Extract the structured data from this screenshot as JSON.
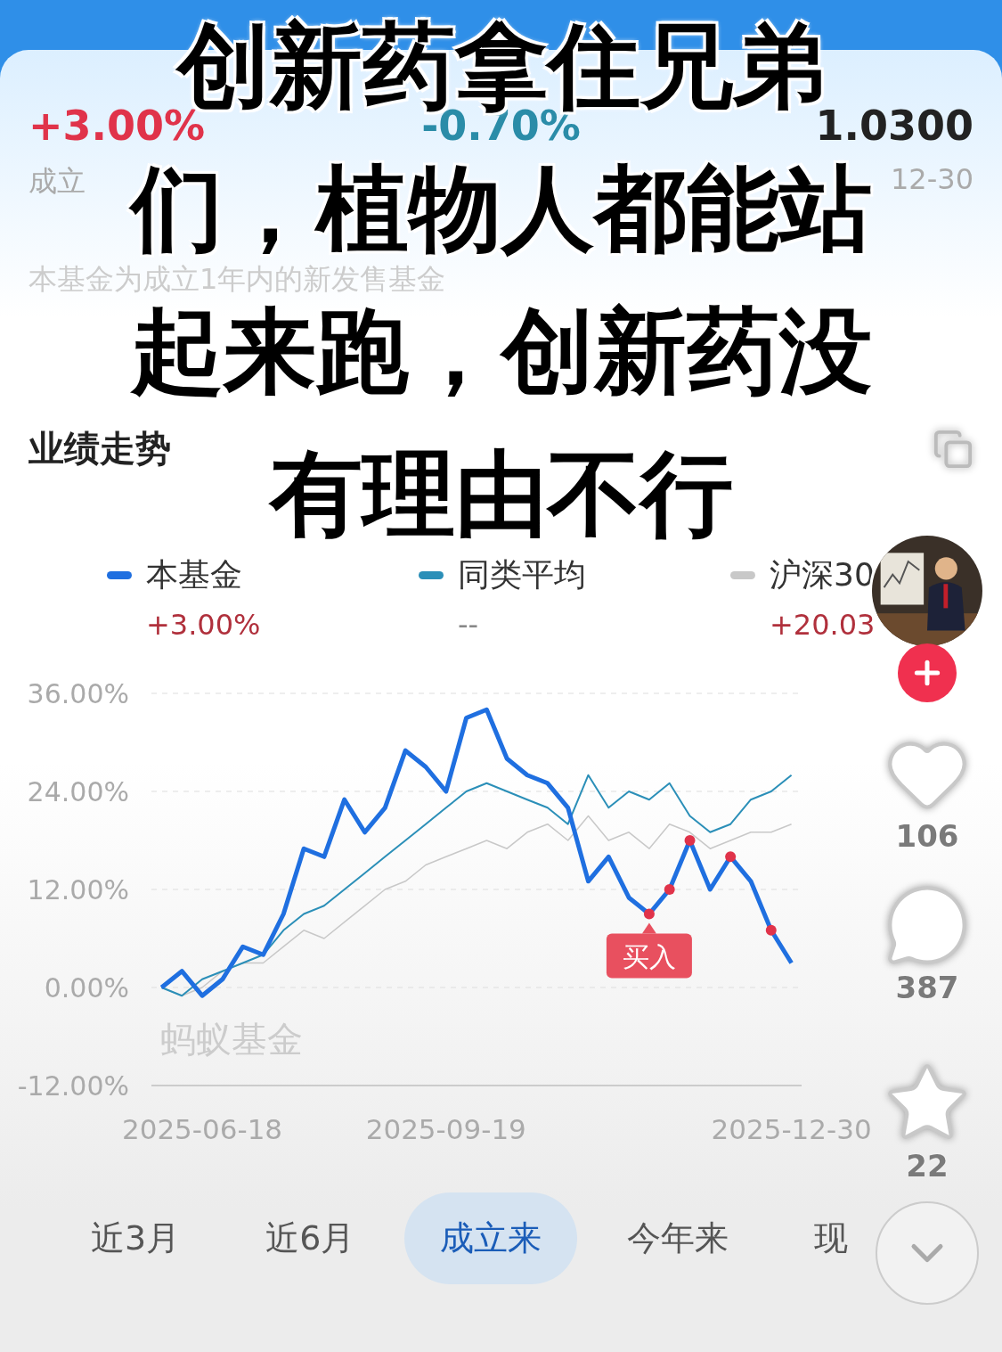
{
  "caption": {
    "lines": [
      "创新药拿住兄弟",
      "们，植物人都能站",
      "起来跑，创新药没",
      "有理由不行"
    ]
  },
  "stats": [
    {
      "value": "+3.00%",
      "label": "成立"
    },
    {
      "value": "-0.70%"
    },
    {
      "value": "1.0300",
      "label": "12-30"
    }
  ],
  "notice": "本基金为成立1年内的新发售基金",
  "section": {
    "title": "业绩走势"
  },
  "legend": [
    {
      "value": "+3.00%"
    },
    {
      "value": "--"
    },
    {
      "value": "+20.03"
    }
  ],
  "chart": {
    "watermark": "蚂蚁基金",
    "chart_data": {
      "type": "line",
      "grid": true,
      "ylim": [
        -12,
        36
      ],
      "yticks": [
        {
          "value": 36,
          "label": "36.00%"
        },
        {
          "value": 24,
          "label": "24.00%"
        },
        {
          "value": 12,
          "label": "12.00%"
        },
        {
          "value": 0,
          "label": "0.00%"
        },
        {
          "value": -12,
          "label": "-12.00%"
        }
      ],
      "categories": [
        null,
        null,
        "2025-06-18",
        null,
        null,
        null,
        null,
        null,
        null,
        null,
        null,
        null,
        null,
        null,
        "2025-09-19",
        null,
        null,
        null,
        null,
        null,
        null,
        null,
        null,
        null,
        null,
        null,
        null,
        null,
        null,
        null,
        null,
        "2025-12-30"
      ],
      "series": [
        {
          "name": "本基金",
          "color": "#1f6fe0",
          "values": [
            0,
            2,
            -1,
            1,
            5,
            4,
            9,
            17,
            16,
            23,
            19,
            22,
            29,
            27,
            24,
            33,
            34,
            28,
            26,
            25,
            22,
            13,
            16,
            11,
            9,
            12,
            18,
            12,
            16,
            13,
            7,
            3
          ]
        },
        {
          "name": "同类平均",
          "color": "#2b8fb8",
          "values": [
            0,
            -1,
            1,
            2,
            3,
            4,
            7,
            9,
            10,
            12,
            14,
            16,
            18,
            20,
            22,
            24,
            25,
            24,
            23,
            22,
            20,
            26,
            22,
            24,
            23,
            25,
            21,
            19,
            20,
            23,
            24,
            26
          ]
        },
        {
          "name": "沪深30",
          "color": "#c8c8c8",
          "values": [
            0,
            -1,
            0,
            2,
            3,
            3,
            5,
            7,
            6,
            8,
            10,
            12,
            13,
            15,
            16,
            17,
            18,
            17,
            19,
            20,
            18,
            21,
            18,
            19,
            17,
            20,
            19,
            17,
            18,
            19,
            19,
            20
          ]
        }
      ],
      "annotations": [
        "买入"
      ]
    }
  },
  "ranges": [
    {
      "label": "近3月",
      "selected": false
    },
    {
      "label": "近6月",
      "selected": false
    },
    {
      "label": "成立来",
      "selected": true
    },
    {
      "label": "今年来",
      "selected": false
    },
    {
      "label": "现",
      "selected": false
    }
  ],
  "side_rail": {
    "likes": "106",
    "comments": "387",
    "favorites": "22"
  }
}
